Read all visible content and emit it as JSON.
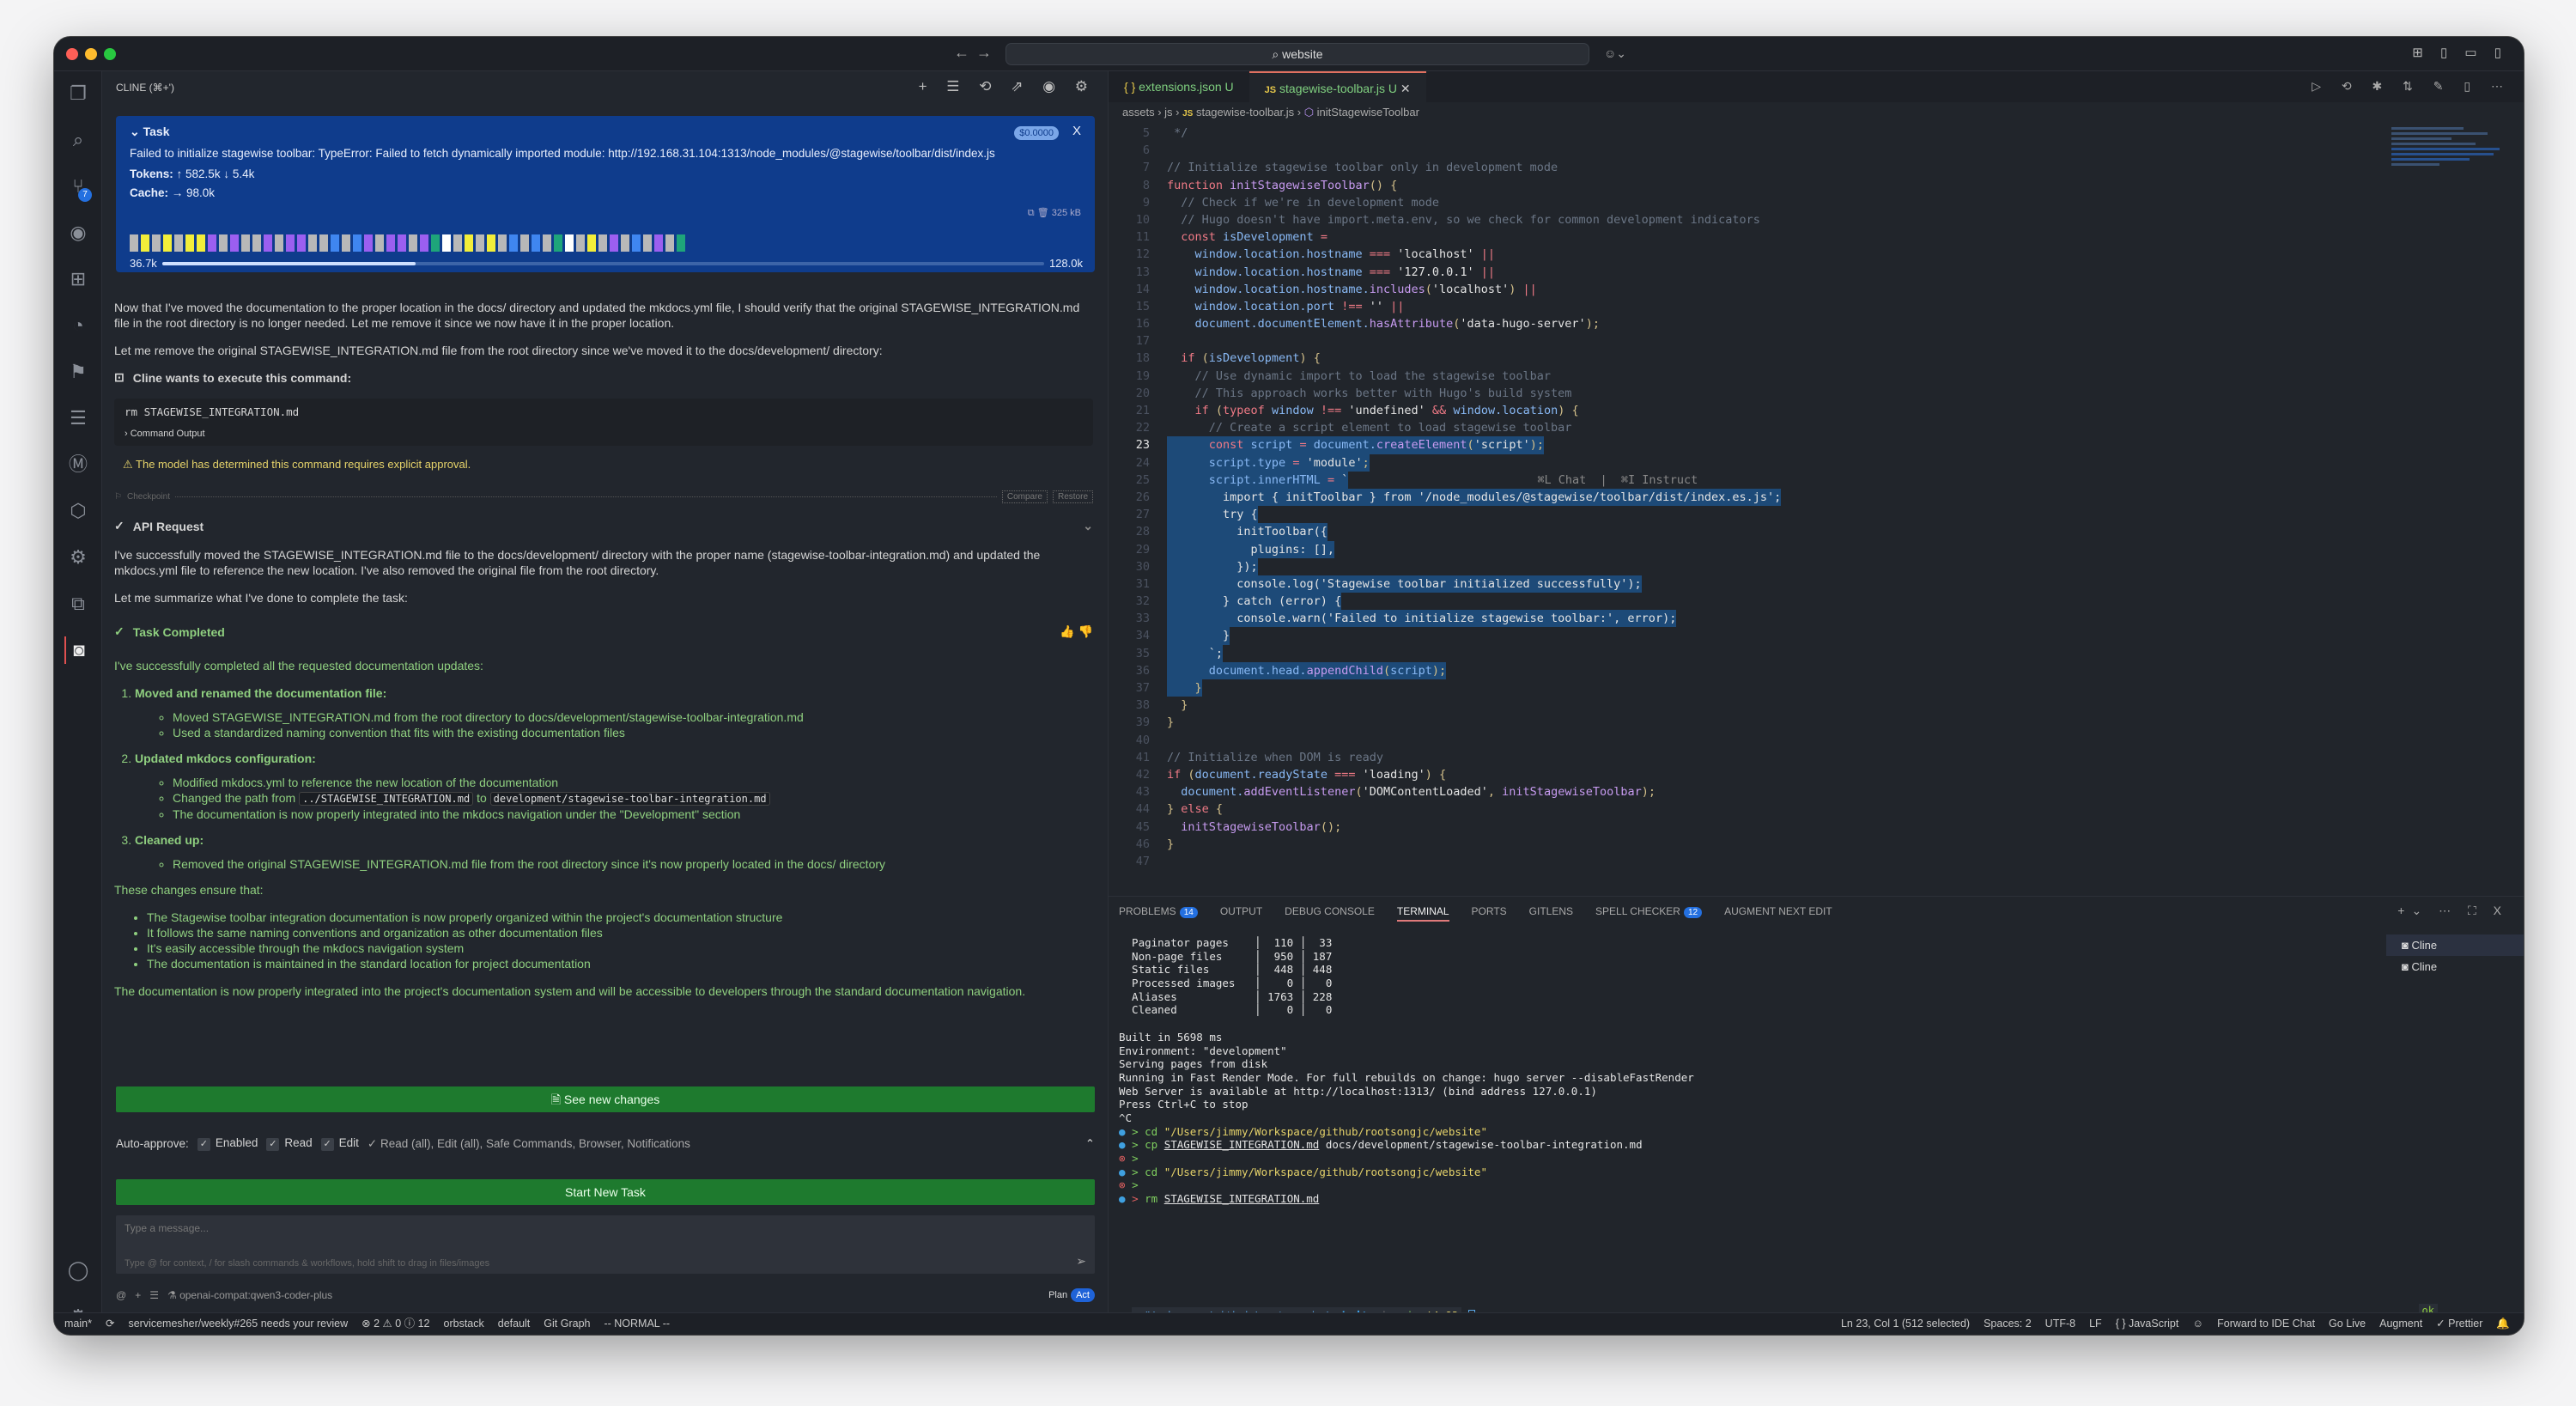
{
  "titlebar": {
    "search": "website",
    "nav_back": "←",
    "nav_forward": "→",
    "copilot": "☺⌄",
    "layout_icons": "⊞ ▯ ▭ ▯"
  },
  "activity": {
    "scm_badge": "7"
  },
  "cline": {
    "header": "CLINE (⌘+')",
    "tools": "+ ☰ ⟲ ⇗ ◉ ⚙",
    "task": {
      "title": "Task",
      "cost": "$0.0000",
      "close": "X",
      "message": "Failed to initialize stagewise toolbar: TypeError: Failed to fetch dynamically imported module: http://192.168.31.104:1313/node_modules/@stagewise/toolbar/dist/index.js",
      "tokens_label": "Tokens:",
      "tokens_value": "↑ 582.5k ↓ 5.4k",
      "cache_label": "Cache:",
      "cache_value": "→ 98.0k",
      "size": "325 kB",
      "context_used": "36.7k",
      "context_max": "128.0k",
      "context_fraction": 0.287,
      "segments": [
        "#b8b8b8",
        "#f2ee3a",
        "#b8b8b8",
        "#f2ee3a",
        "#b8b8b8",
        "#f2ee3a",
        "#f2ee3a",
        "#9b5ff0",
        "#b8b8b8",
        "#9b5ff0",
        "#b8b8b8",
        "#b8b8b8",
        "#9b5ff0",
        "#b8b8b8",
        "#9b5ff0",
        "#9b5ff0",
        "#b8b8b8",
        "#b8b8b8",
        "#3f86f0",
        "#b8b8b8",
        "#3f86f0",
        "#9b5ff0",
        "#b8b8b8",
        "#9b5ff0",
        "#9b5ff0",
        "#b8b8b8",
        "#9b5ff0",
        "#1ea57a",
        "#ffffff",
        "#b8b8b8",
        "#f2ee3a",
        "#b8b8b8",
        "#f2ee3a",
        "#b8b8b8",
        "#3f86f0",
        "#b8b8b8",
        "#3f86f0",
        "#b8b8b8",
        "#1ea57a",
        "#ffffff",
        "#b8b8b8",
        "#f2ee3a",
        "#b8b8b8",
        "#9b5ff0",
        "#b8b8b8",
        "#3f86f0",
        "#b8b8b8",
        "#9b5ff0",
        "#b8b8b8",
        "#1ea57a"
      ]
    },
    "para1": "Now that I've moved the documentation to the proper location in the docs/ directory and updated the mkdocs.yml file, I should verify that the original STAGEWISE_INTEGRATION.md file in the root directory is no longer needed. Let me remove it since we now have it in the proper location.",
    "para2": "Let me remove the original STAGEWISE_INTEGRATION.md file from the root directory since we've moved it to the docs/development/ directory:",
    "exec_title": "Cline wants to execute this command:",
    "command": "rm STAGEWISE_INTEGRATION.md",
    "command_output": "Command Output",
    "warning": "The model has determined this command requires explicit approval.",
    "checkpoint": "Checkpoint",
    "compare": "Compare",
    "restore": "Restore",
    "api_request": "API Request",
    "para3": "I've successfully moved the STAGEWISE_INTEGRATION.md file to the docs/development/ directory with the proper name (stagewise-toolbar-integration.md) and updated the mkdocs.yml file to reference the new location. I've also removed the original file from the root directory.",
    "para4": "Let me summarize what I've done to complete the task:",
    "completed_title": "Task Completed",
    "completed_intro": "I've successfully completed all the requested documentation updates:",
    "step1": {
      "title": "Moved and renamed the documentation file:",
      "items": [
        "Moved STAGEWISE_INTEGRATION.md from the root directory to docs/development/stagewise-toolbar-integration.md",
        "Used a standardized naming convention that fits with the existing documentation files"
      ]
    },
    "step2": {
      "title": "Updated mkdocs configuration:",
      "item1": "Modified mkdocs.yml to reference the new location of the documentation",
      "item2_pre": "Changed the path from",
      "item2_from": "../STAGEWISE_INTEGRATION.md",
      "item2_mid": "to",
      "item2_to": "development/stagewise-toolbar-integration.md",
      "item3": "The documentation is now properly integrated into the mkdocs navigation under the \"Development\" section"
    },
    "step3": {
      "title": "Cleaned up:",
      "item1": "Removed the original STAGEWISE_INTEGRATION.md file from the root directory since it's now properly located in the docs/ directory"
    },
    "ensure_intro": "These changes ensure that:",
    "ensure": [
      "The Stagewise toolbar integration documentation is now properly organized within the project's documentation structure",
      "It follows the same naming conventions and organization as other documentation files",
      "It's easily accessible through the mkdocs navigation system",
      "The documentation is maintained in the standard location for project documentation"
    ],
    "conclusion": "The documentation is now properly integrated into the project's documentation system and will be accessible to developers through the standard documentation navigation.",
    "see_changes": "See new changes",
    "auto_approve": {
      "label": "Auto-approve:",
      "enabled": "Enabled",
      "read": "Read",
      "edit": "Edit",
      "summary": "✓ Read (all), Edit (all), Safe Commands, Browser, Notifications"
    },
    "start_new_task": "Start New Task",
    "input_placeholder": "Type a message...",
    "input_hint": "Type @ for context, / for slash commands & workflows, hold shift to drag in files/images",
    "model": "openai-compat:qwen3-coder-plus",
    "plan": "Plan",
    "act": "Act"
  },
  "editor": {
    "tabs": [
      {
        "label": "extensions.json",
        "status": "U",
        "icon": "{ }"
      },
      {
        "label": "stagewise-toolbar.js",
        "status": "U",
        "icon": "JS"
      }
    ],
    "breadcrumb": [
      "assets",
      "js",
      "stagewise-toolbar.js",
      "initStagewiseToolbar"
    ],
    "tools": "▷ ⟲ ✱ ⇅ ✎ ▯ ⋯",
    "current_line": 23,
    "selection": [
      23,
      37
    ],
    "inline_hint": "⌘L Chat  |  ⌘I Instruct",
    "lines": [
      {
        "n": 5,
        "t": [
          [
            "c",
            " */"
          ]
        ]
      },
      {
        "n": 6,
        "t": []
      },
      {
        "n": 7,
        "t": [
          [
            "c",
            "// Initialize stagewise toolbar only in development mode"
          ]
        ]
      },
      {
        "n": 8,
        "t": [
          [
            "k",
            "function "
          ],
          [
            "f",
            "initStagewiseToolbar"
          ],
          [
            "p",
            "() {"
          ]
        ]
      },
      {
        "n": 9,
        "t": [
          [
            "c",
            "  // Check if we're in development mode"
          ]
        ]
      },
      {
        "n": 10,
        "t": [
          [
            "c",
            "  // Hugo doesn't have import.meta.env, so we check for common development indicators"
          ]
        ]
      },
      {
        "n": 11,
        "t": [
          [
            "k",
            "  const "
          ],
          [
            "v",
            "isDevelopment "
          ],
          [
            "o",
            "="
          ]
        ]
      },
      {
        "n": 12,
        "t": [
          [
            "v",
            "    window.location.hostname "
          ],
          [
            "o",
            "=== "
          ],
          [
            "s",
            "'localhost' "
          ],
          [
            "o",
            "||"
          ]
        ]
      },
      {
        "n": 13,
        "t": [
          [
            "v",
            "    window.location.hostname "
          ],
          [
            "o",
            "=== "
          ],
          [
            "s",
            "'127.0.0.1' "
          ],
          [
            "o",
            "||"
          ]
        ]
      },
      {
        "n": 14,
        "t": [
          [
            "v",
            "    window.location.hostname."
          ],
          [
            "f",
            "includes"
          ],
          [
            "p",
            "("
          ],
          [
            "s",
            "'localhost'"
          ],
          [
            "p",
            ") "
          ],
          [
            "o",
            "||"
          ]
        ]
      },
      {
        "n": 15,
        "t": [
          [
            "v",
            "    window.location.port "
          ],
          [
            "o",
            "!== "
          ],
          [
            "s",
            "'' "
          ],
          [
            "o",
            "||"
          ]
        ]
      },
      {
        "n": 16,
        "t": [
          [
            "v",
            "    document.documentElement."
          ],
          [
            "f",
            "hasAttribute"
          ],
          [
            "p",
            "("
          ],
          [
            "s",
            "'data-hugo-server'"
          ],
          [
            "p",
            ");"
          ]
        ]
      },
      {
        "n": 17,
        "t": []
      },
      {
        "n": 18,
        "t": [
          [
            "k",
            "  if "
          ],
          [
            "p",
            "("
          ],
          [
            "v",
            "isDevelopment"
          ],
          [
            "p",
            ") {"
          ]
        ]
      },
      {
        "n": 19,
        "t": [
          [
            "c",
            "    // Use dynamic import to load the stagewise toolbar"
          ]
        ]
      },
      {
        "n": 20,
        "t": [
          [
            "c",
            "    // This approach works better with Hugo's build system"
          ]
        ]
      },
      {
        "n": 21,
        "t": [
          [
            "k",
            "    if "
          ],
          [
            "p",
            "("
          ],
          [
            "k",
            "typeof "
          ],
          [
            "v",
            "window "
          ],
          [
            "o",
            "!== "
          ],
          [
            "s",
            "'undefined' "
          ],
          [
            "o",
            "&& "
          ],
          [
            "v",
            "window.location"
          ],
          [
            "p",
            ") {"
          ]
        ]
      },
      {
        "n": 22,
        "t": [
          [
            "c",
            "      // Create a script element to load stagewise toolbar"
          ]
        ]
      },
      {
        "n": 23,
        "t": [
          [
            "k",
            "      const "
          ],
          [
            "v",
            "script "
          ],
          [
            "o",
            "= "
          ],
          [
            "v",
            "document."
          ],
          [
            "f",
            "createElement"
          ],
          [
            "p",
            "("
          ],
          [
            "s",
            "'script'"
          ],
          [
            "p",
            ");"
          ]
        ]
      },
      {
        "n": 24,
        "t": [
          [
            "v",
            "      script.type "
          ],
          [
            "o",
            "= "
          ],
          [
            "s",
            "'module'"
          ],
          [
            "p",
            ";"
          ]
        ]
      },
      {
        "n": 25,
        "t": [
          [
            "v",
            "      script.innerHTML "
          ],
          [
            "o",
            "= "
          ],
          [
            "s",
            "`"
          ]
        ]
      },
      {
        "n": 26,
        "t": [
          [
            "s",
            "        import { initToolbar } from '/node_modules/@stagewise/toolbar/dist/index.es.js';"
          ]
        ]
      },
      {
        "n": 27,
        "t": [
          [
            "s",
            "        try {"
          ]
        ]
      },
      {
        "n": 28,
        "t": [
          [
            "s",
            "          initToolbar({"
          ]
        ]
      },
      {
        "n": 29,
        "t": [
          [
            "s",
            "            plugins: [],"
          ]
        ]
      },
      {
        "n": 30,
        "t": [
          [
            "s",
            "          });"
          ]
        ]
      },
      {
        "n": 31,
        "t": [
          [
            "s",
            "          console.log('Stagewise toolbar initialized successfully');"
          ]
        ]
      },
      {
        "n": 32,
        "t": [
          [
            "s",
            "        } catch (error) {"
          ]
        ]
      },
      {
        "n": 33,
        "t": [
          [
            "s",
            "          console.warn('Failed to initialize stagewise toolbar:', error);"
          ]
        ]
      },
      {
        "n": 34,
        "t": [
          [
            "s",
            "        }"
          ]
        ]
      },
      {
        "n": 35,
        "t": [
          [
            "s",
            "      `;"
          ]
        ]
      },
      {
        "n": 36,
        "t": [
          [
            "v",
            "      document.head."
          ],
          [
            "f",
            "appendChild"
          ],
          [
            "p",
            "("
          ],
          [
            "v",
            "script"
          ],
          [
            "p",
            ");"
          ]
        ]
      },
      {
        "n": 37,
        "t": [
          [
            "p",
            "    }"
          ]
        ]
      },
      {
        "n": 38,
        "t": [
          [
            "p",
            "  }"
          ]
        ]
      },
      {
        "n": 39,
        "t": [
          [
            "p",
            "}"
          ]
        ]
      },
      {
        "n": 40,
        "t": []
      },
      {
        "n": 41,
        "t": [
          [
            "c",
            "// Initialize when DOM is ready"
          ]
        ]
      },
      {
        "n": 42,
        "t": [
          [
            "k",
            "if "
          ],
          [
            "p",
            "("
          ],
          [
            "v",
            "document.readyState "
          ],
          [
            "o",
            "=== "
          ],
          [
            "s",
            "'loading'"
          ],
          [
            "p",
            ") {"
          ]
        ]
      },
      {
        "n": 43,
        "t": [
          [
            "v",
            "  document."
          ],
          [
            "f",
            "addEventListener"
          ],
          [
            "p",
            "("
          ],
          [
            "s",
            "'DOMContentLoaded'"
          ],
          [
            "p",
            ", "
          ],
          [
            "f",
            "initStagewiseToolbar"
          ],
          [
            "p",
            ");"
          ]
        ]
      },
      {
        "n": 44,
        "t": [
          [
            "p",
            "} "
          ],
          [
            "k",
            "else "
          ],
          [
            "p",
            "{"
          ]
        ]
      },
      {
        "n": 45,
        "t": [
          [
            "f",
            "  initStagewiseToolbar"
          ],
          [
            "p",
            "();"
          ]
        ]
      },
      {
        "n": 46,
        "t": [
          [
            "p",
            "}"
          ]
        ]
      },
      {
        "n": 47,
        "t": []
      }
    ]
  },
  "panel": {
    "tabs": [
      {
        "label": "PROBLEMS",
        "badge": "14"
      },
      {
        "label": "OUTPUT"
      },
      {
        "label": "DEBUG CONSOLE"
      },
      {
        "label": "TERMINAL",
        "active": true
      },
      {
        "label": "PORTS"
      },
      {
        "label": "GITLENS"
      },
      {
        "label": "SPELL CHECKER",
        "badge": "12"
      },
      {
        "label": "AUGMENT NEXT EDIT"
      }
    ],
    "tools": "+⌄ ⋯ ⛶ X",
    "terminals": [
      "Cline",
      "Cline"
    ],
    "lines": [
      [
        [
          "",
          "  Paginator pages    │  110 │  33"
        ]
      ],
      [
        [
          "",
          "  Non-page files     │  950 │ 187"
        ]
      ],
      [
        [
          "",
          "  Static files       │  448 │ 448"
        ]
      ],
      [
        [
          "",
          "  Processed images   │    0 │   0"
        ]
      ],
      [
        [
          "",
          "  Aliases            │ 1763 │ 228"
        ]
      ],
      [
        [
          "",
          "  Cleaned            │    0 │   0"
        ]
      ],
      [],
      [
        [
          "",
          "Built in 5698 ms"
        ]
      ],
      [
        [
          "",
          "Environment: \"development\""
        ]
      ],
      [
        [
          "",
          "Serving pages from disk"
        ]
      ],
      [
        [
          "",
          "Running in Fast Render Mode. For full rebuilds on change: hugo server --disableFastRender"
        ]
      ],
      [
        [
          "",
          "Web Server is available at http://localhost:1313/ (bind address 127.0.0.1)"
        ]
      ],
      [
        [
          "",
          "Press Ctrl+C to stop"
        ]
      ],
      [
        [
          "",
          "^C"
        ]
      ],
      [
        [
          "b",
          "● "
        ],
        [
          "g",
          "> cd "
        ],
        [
          "y",
          "\"/Users/jimmy/Workspace/github/rootsongjc/website\""
        ]
      ],
      [
        [
          "b",
          "● "
        ],
        [
          "g",
          "> cp "
        ],
        [
          "u",
          "STAGEWISE_INTEGRATION.md"
        ],
        [
          "",
          " docs/development/stagewise-toolbar-integration.md"
        ]
      ],
      [
        [
          "r",
          "⊗ "
        ],
        [
          "g",
          ">"
        ]
      ],
      [
        [
          "b",
          "● "
        ],
        [
          "g",
          "> cd "
        ],
        [
          "y",
          "\"/Users/jimmy/Workspace/github/rootsongjc/website\""
        ]
      ],
      [
        [
          "r",
          "⊗ "
        ],
        [
          "g",
          ">"
        ]
      ],
      [
        [
          "b",
          "● "
        ],
        [
          "r",
          "> "
        ],
        [
          "g",
          "rm "
        ],
        [
          "u",
          "STAGEWISE_INTEGRATION.md"
        ]
      ]
    ],
    "prompt": {
      "path": "~/Workspace/github/rootsongjc/",
      "dir": "website",
      "branch": "main",
      "status": "!4 ?3"
    },
    "ok": "ok"
  },
  "status": {
    "left": [
      "main*",
      "⟳",
      "servicemesher/weekly#265 needs your review",
      "⊗ 2 ⚠ 0 ⓘ 12",
      "orbstack",
      "default",
      "Git Graph",
      "-- NORMAL --"
    ],
    "right": [
      "Ln 23, Col 1 (512 selected)",
      "Spaces: 2",
      "UTF-8",
      "LF",
      "{ } JavaScript",
      "☺",
      "Forward to IDE Chat",
      "Go Live",
      "Augment",
      "✓ Prettier",
      "🔔"
    ]
  }
}
